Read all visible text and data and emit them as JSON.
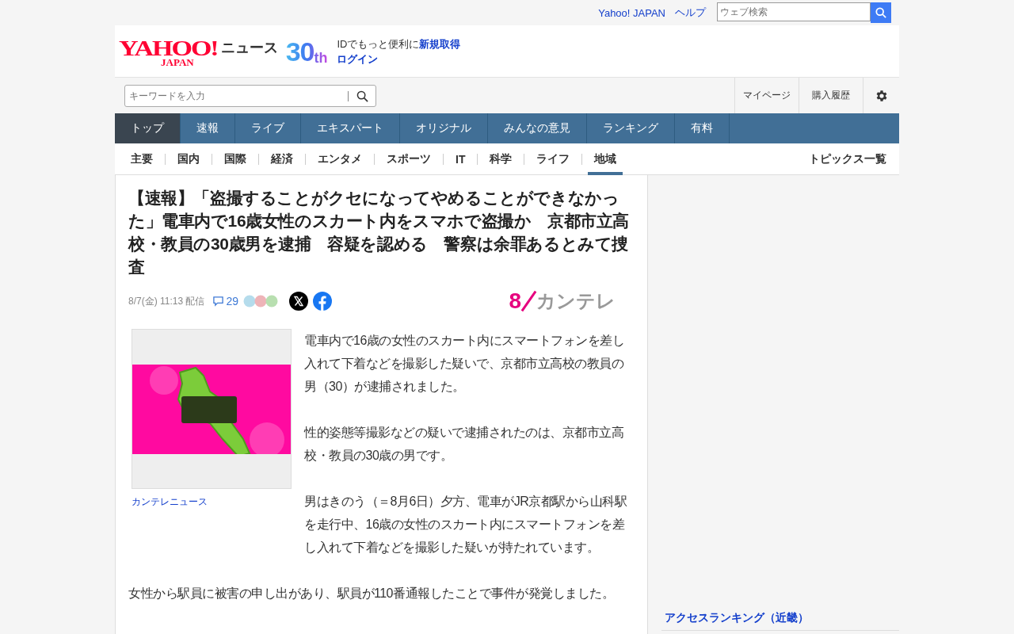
{
  "top_links": [
    "Yahoo! JAPAN",
    "ヘルプ"
  ],
  "web_search": {
    "placeholder": "ウェブ検索"
  },
  "logo": {
    "main": "YAHOO!",
    "sub": "JAPAN",
    "service": "ニュース",
    "anniversary_number": "30",
    "anniversary_suffix": "th"
  },
  "login": {
    "prompt": "IDでもっと便利に",
    "register": "新規取得",
    "login": "ログイン"
  },
  "keyword_search": {
    "placeholder": "キーワードを入力"
  },
  "user_links": [
    "マイページ",
    "購入履歴"
  ],
  "main_nav": [
    {
      "label": "トップ",
      "selected": true
    },
    {
      "label": "速報",
      "selected": false
    },
    {
      "label": "ライブ",
      "selected": false
    },
    {
      "label": "エキスパート",
      "selected": false
    },
    {
      "label": "オリジナル",
      "selected": false
    },
    {
      "label": "みんなの意見",
      "selected": false
    },
    {
      "label": "ランキング",
      "selected": false
    },
    {
      "label": "有料",
      "selected": false
    }
  ],
  "category_nav": [
    {
      "label": "主要",
      "selected": false
    },
    {
      "label": "国内",
      "selected": false
    },
    {
      "label": "国際",
      "selected": false
    },
    {
      "label": "経済",
      "selected": false
    },
    {
      "label": "エンタメ",
      "selected": false
    },
    {
      "label": "スポーツ",
      "selected": false
    },
    {
      "label": "IT",
      "selected": false
    },
    {
      "label": "科学",
      "selected": false
    },
    {
      "label": "ライフ",
      "selected": false
    },
    {
      "label": "地域",
      "selected": true
    }
  ],
  "topics_link": "トピックス一覧",
  "article": {
    "title": "【速報】「盗撮することがクセになってやめることができなかった」電車内で16歳女性のスカート内をスマホで盗撮か　京都市立高校・教員の30歳男を逮捕　容疑を認める　警察は余罪あるとみて捜査",
    "date": "8/7(金) 11:13 配信",
    "comments": "29",
    "source_logo": "カンテレ",
    "source_logo_mark": "8",
    "image": {
      "kind": "picture",
      "caption": "カンテレニュース"
    },
    "paragraphs": [
      "電車内で16歳の女性のスカート内にスマートフォンを差し入れて下着などを撮影した疑いで、京都市立高校の教員の男（30）が逮捕されました。",
      "性的姿態等撮影などの疑いで逮捕されたのは、京都市立高校・教員の30歳の男です。",
      "男はきのう（＝8月6日）夕方、電車がJR京都駅から山科駅を走行中、16歳の女性のスカート内にスマートフォンを差し入れて下着などを撮影した疑いが持たれています。",
      "女性から駅員に被害の申し出があり、駅員が110番通報したことで事件が発覚しました。"
    ]
  },
  "sidebar": {
    "ranking_title": "アクセスランキング（近畿）"
  }
}
